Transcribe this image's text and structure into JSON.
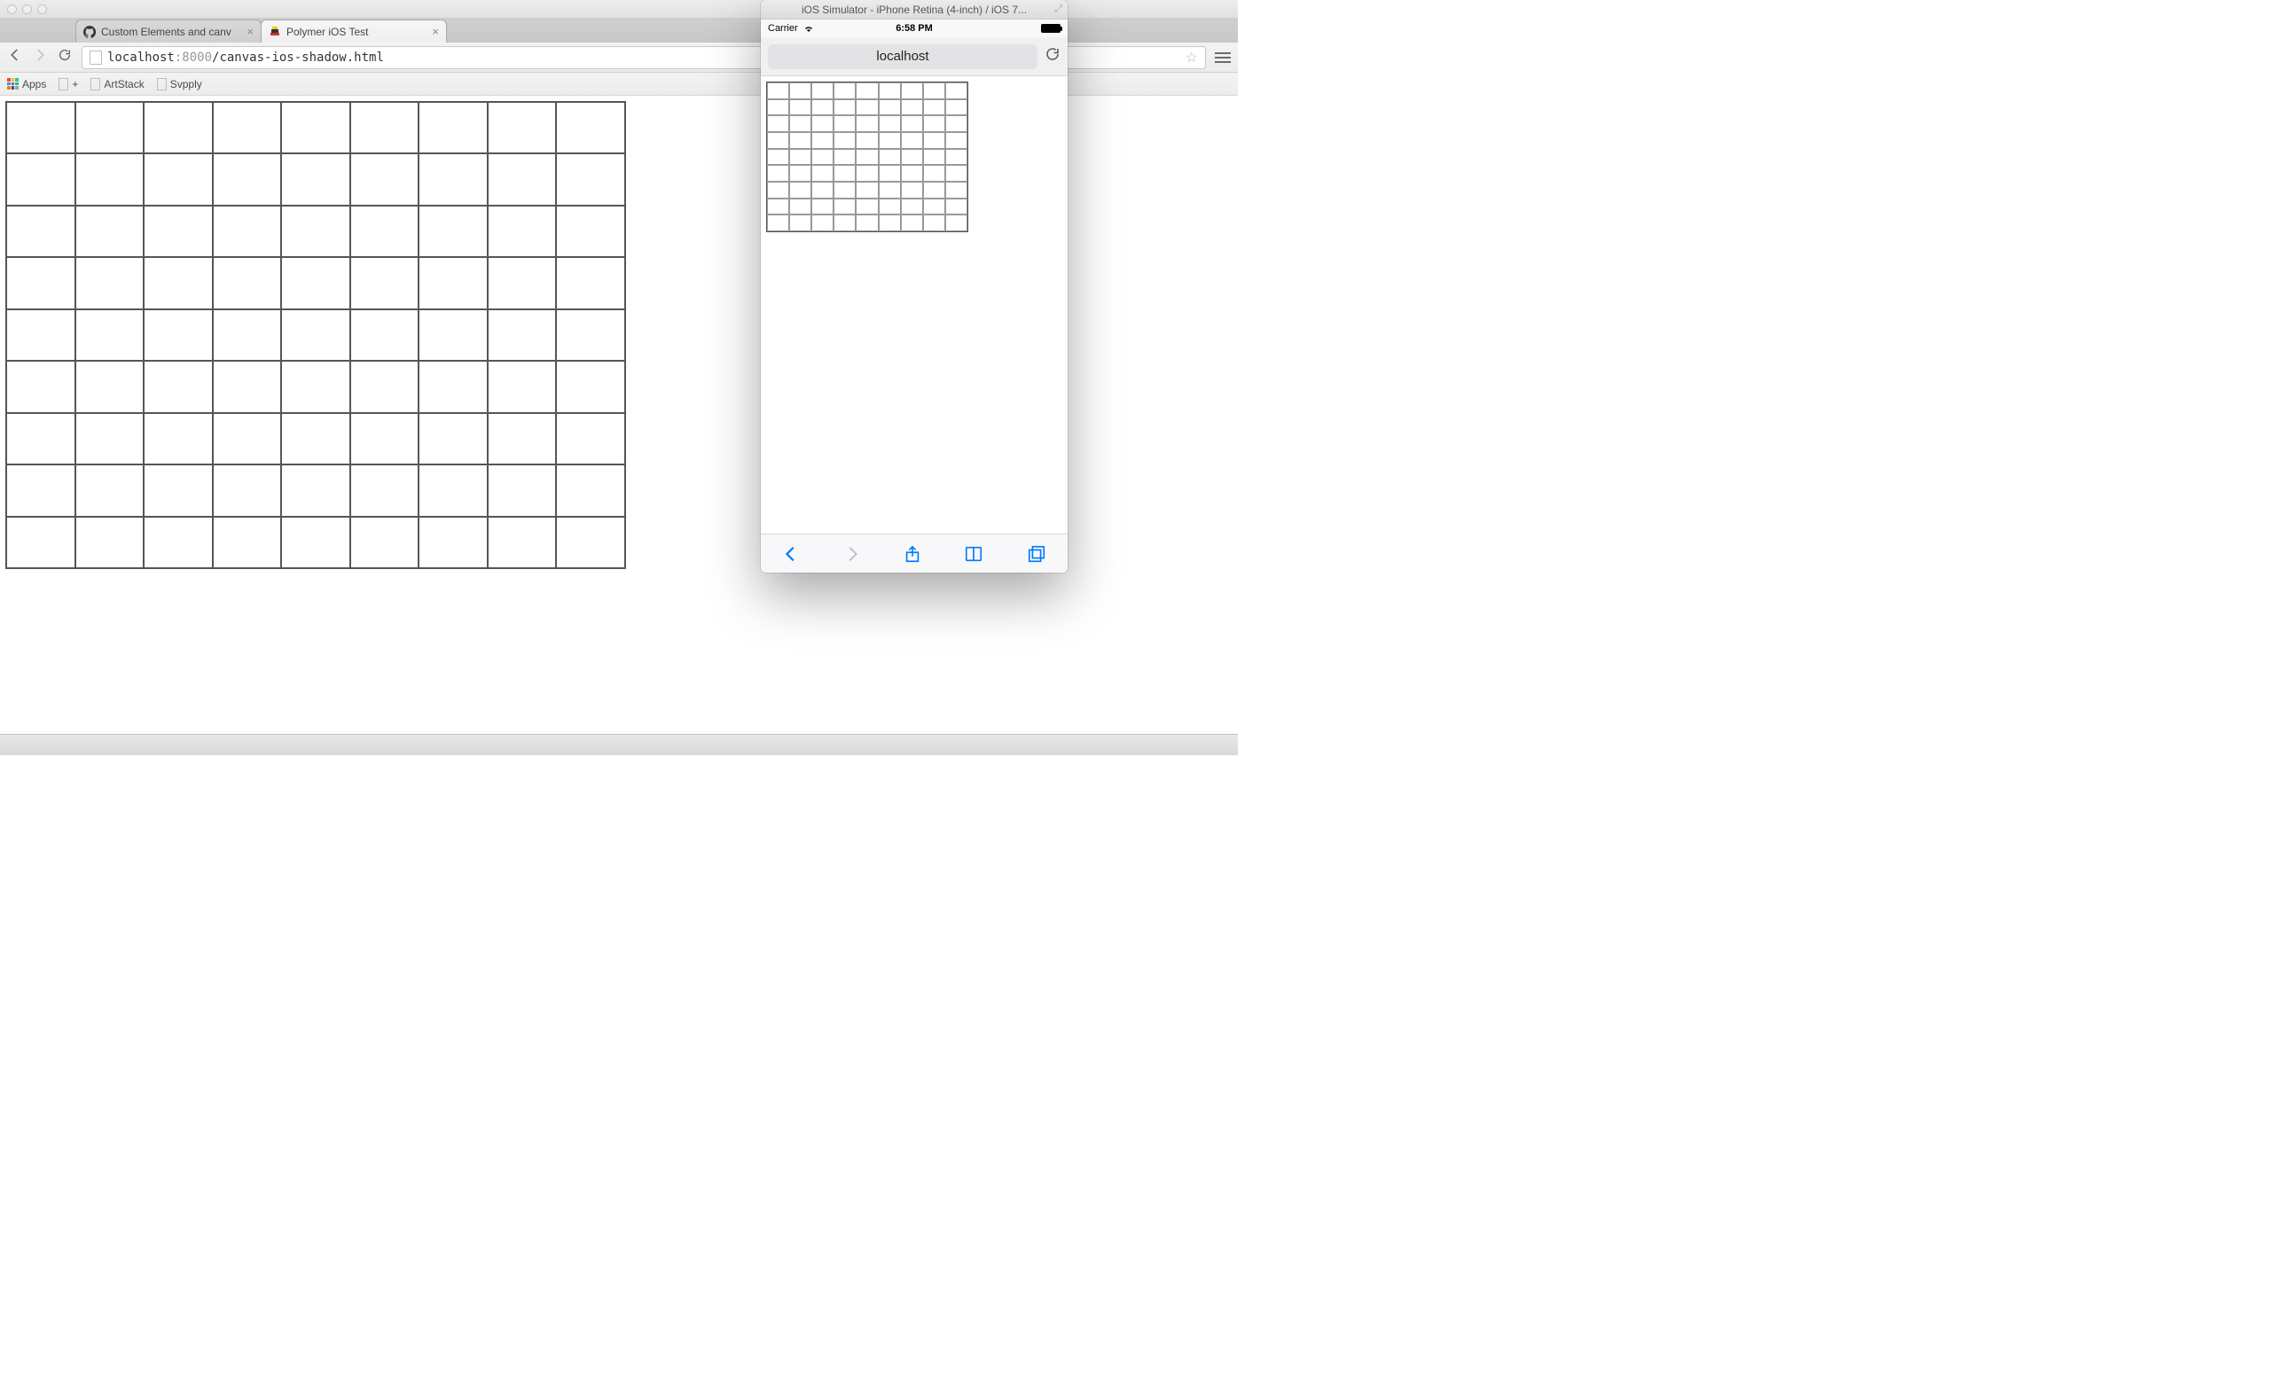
{
  "chrome": {
    "tabs": [
      {
        "title": "Custom Elements and canv",
        "active": false,
        "favicon": "github"
      },
      {
        "title": "Polymer iOS Test",
        "active": true,
        "favicon": "polymer"
      }
    ],
    "nav": {
      "back": "←",
      "forward": "→",
      "reload": "↻"
    },
    "omnibox": {
      "host": "localhost",
      "port": ":8000",
      "path": "/canvas-ios-shadow.html"
    },
    "bookmarks": {
      "apps_label": "Apps",
      "items": [
        {
          "label": "+"
        },
        {
          "label": "ArtStack"
        },
        {
          "label": "Svpply"
        }
      ]
    },
    "grid": {
      "cols": 9,
      "rows": 9
    }
  },
  "simulator": {
    "window_title": "iOS Simulator - iPhone Retina (4-inch) / iOS 7...",
    "status": {
      "carrier": "Carrier",
      "time": "6:58 PM"
    },
    "safari": {
      "address": "localhost"
    },
    "grid": {
      "cols": 9,
      "rows": 9
    }
  }
}
